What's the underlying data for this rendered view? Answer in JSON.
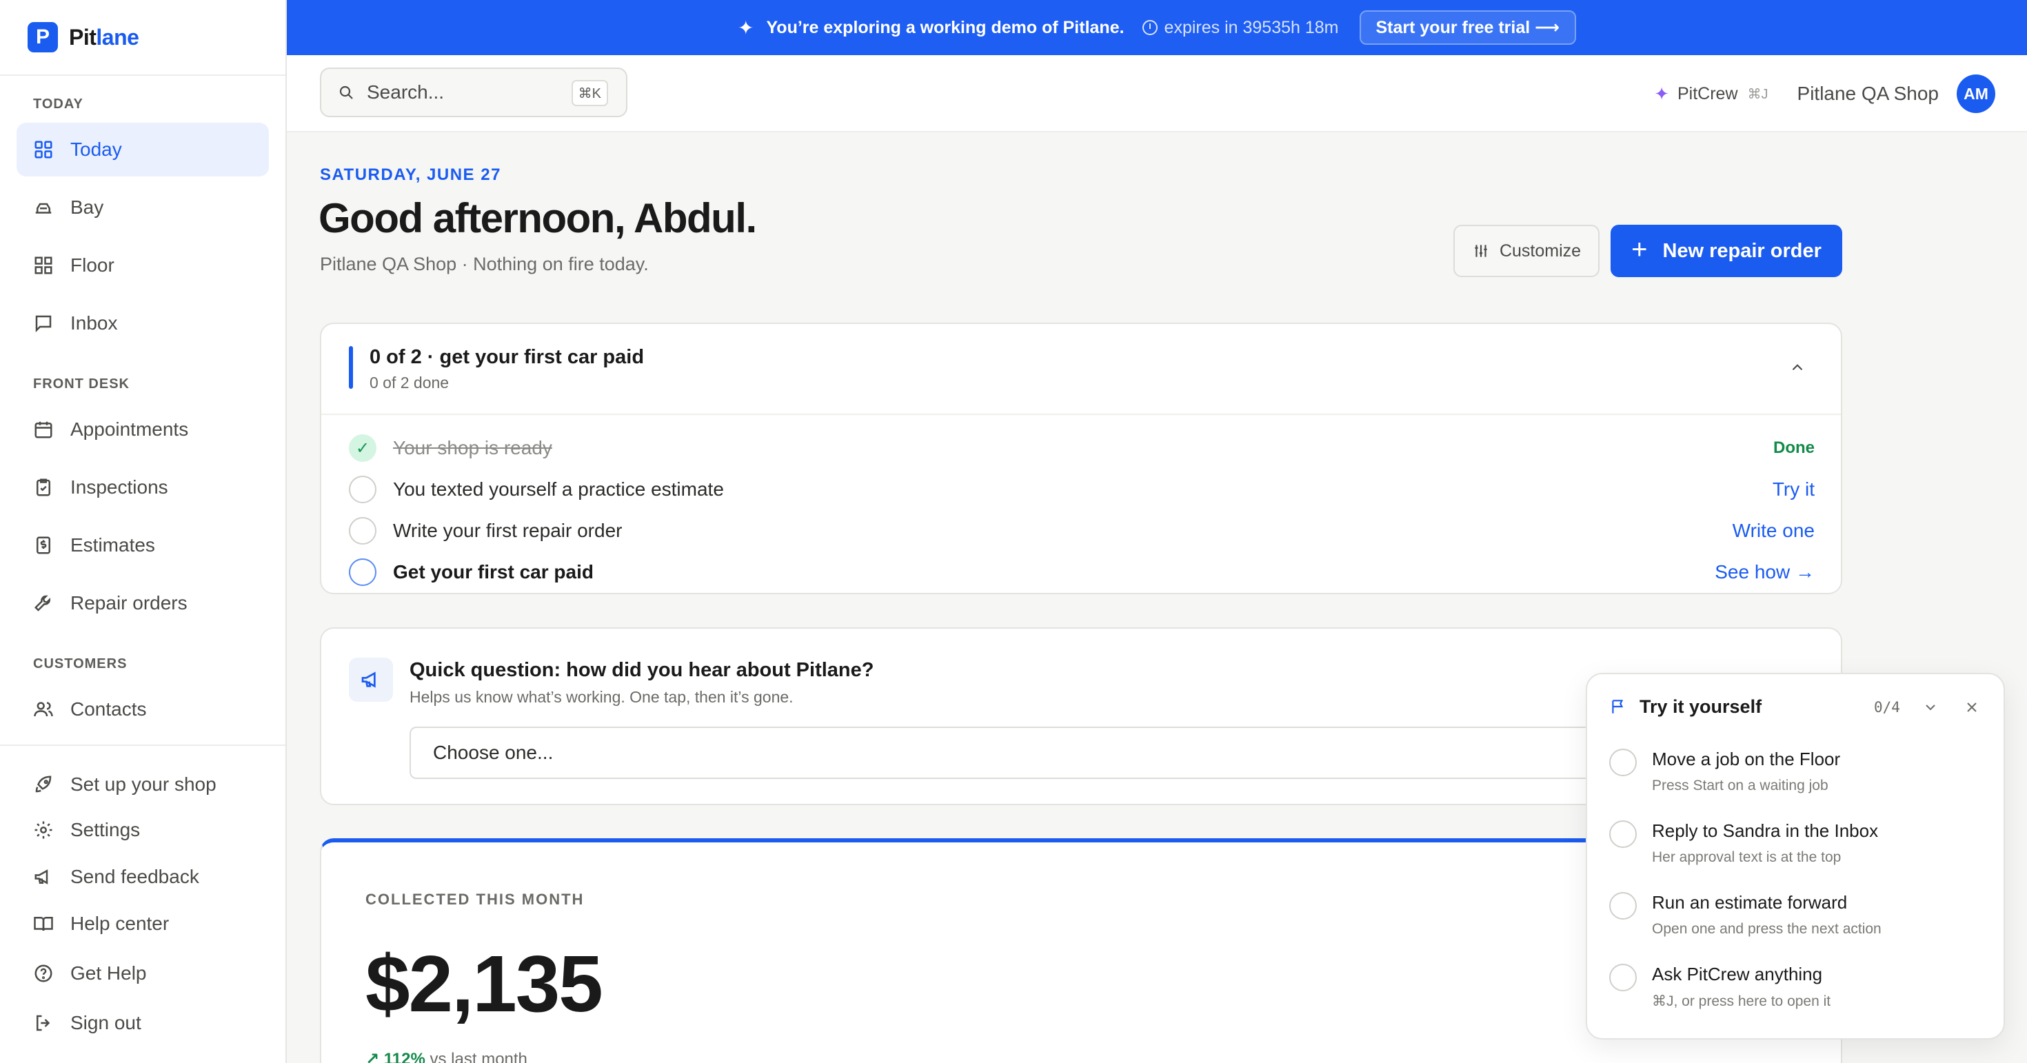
{
  "brand": {
    "name_a": "Pit",
    "name_b": "lane",
    "logo_letter": "P",
    "color": "#1a5bf0"
  },
  "sidebar": {
    "sections": {
      "today": "TODAY",
      "front_desk": "FRONT DESK",
      "customers": "CUSTOMERS"
    },
    "items": [
      {
        "label": "Today",
        "icon": "grid-icon",
        "active": true
      },
      {
        "label": "Bay",
        "icon": "bay-icon"
      },
      {
        "label": "Floor",
        "icon": "floor-icon"
      },
      {
        "label": "Inbox",
        "icon": "message-icon"
      },
      {
        "label": "Appointments",
        "icon": "calendar-icon"
      },
      {
        "label": "Inspections",
        "icon": "clipboard-check-icon"
      },
      {
        "label": "Estimates",
        "icon": "dollar-receipt-icon"
      },
      {
        "label": "Repair orders",
        "icon": "wrench-icon"
      },
      {
        "label": "Contacts",
        "icon": "users-icon"
      }
    ],
    "footer": [
      {
        "label": "Set up your shop",
        "icon": "rocket-icon"
      },
      {
        "label": "Settings",
        "icon": "gear-icon"
      },
      {
        "label": "Send feedback",
        "icon": "megaphone-icon"
      },
      {
        "label": "Help center",
        "icon": "book-icon"
      },
      {
        "label": "Get Help",
        "icon": "help-circle-icon"
      },
      {
        "label": "Sign out",
        "icon": "sign-out-icon"
      }
    ]
  },
  "banner": {
    "message": "You’re exploring a working demo of Pitlane.",
    "expires": "expires in 39535h 18m",
    "cta": "Start your free trial ⟶"
  },
  "header": {
    "search_placeholder": "Search...",
    "search_shortcut": "⌘K",
    "pitcrew_label": "PitCrew",
    "pitcrew_shortcut": "⌘J",
    "shop_name": "Pitlane QA Shop",
    "avatar_initials": "AM"
  },
  "main": {
    "date": "SATURDAY, JUNE 27",
    "greeting": "Good afternoon, Abdul.",
    "subline": "Pitlane QA Shop · Nothing on fire today.",
    "customize_label": "Customize",
    "new_order_label": "New repair order"
  },
  "checklist": {
    "title": "0 of 2 · get your first car paid",
    "subtitle": "0 of 2 done",
    "rows": [
      {
        "text": "Your shop is ready",
        "action": "Done",
        "state": "done"
      },
      {
        "text": "You texted yourself a practice estimate",
        "action": "Try it",
        "state": "todo"
      },
      {
        "text": "Write your first repair order",
        "action": "Write one",
        "state": "todo"
      },
      {
        "text": "Get your first car paid",
        "action": "See how →",
        "state": "next"
      }
    ]
  },
  "question": {
    "title": "Quick question: how did you hear about Pitlane?",
    "subtitle": "Helps us know what’s working. One tap, then it’s gone.",
    "select_value": "Choose one..."
  },
  "collected": {
    "label": "COLLECTED THIS MONTH",
    "amount": "$2,135",
    "delta": "↗ 112%",
    "delta_suffix": " vs last month"
  },
  "try_panel": {
    "title": "Try it yourself",
    "count": "0/4",
    "items": [
      {
        "title": "Move a job on the Floor",
        "sub": "Press Start on a waiting job"
      },
      {
        "title": "Reply to Sandra in the Inbox",
        "sub": "Her approval text is at the top"
      },
      {
        "title": "Run an estimate forward",
        "sub": "Open one and press the next action"
      },
      {
        "title": "Ask PitCrew anything",
        "sub": "⌘J, or press here to open it"
      }
    ]
  }
}
